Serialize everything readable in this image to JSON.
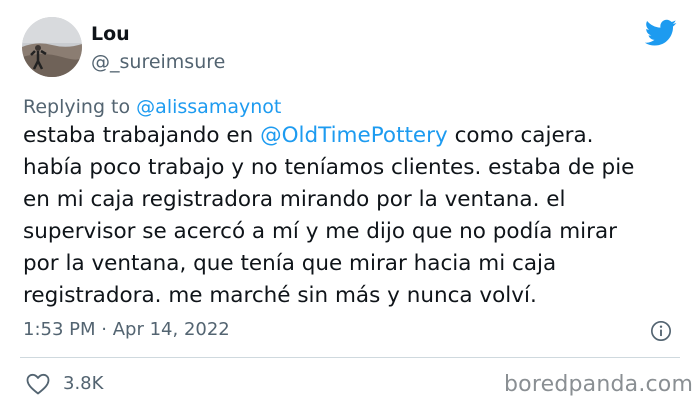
{
  "author": {
    "display_name": "Lou",
    "handle": "@_sureimsure"
  },
  "reply": {
    "prefix": "Replying to",
    "to_handle": "@alissamaynot"
  },
  "tweet": {
    "text_before_mention": "estaba trabajando en ",
    "mention": "@OldTimePottery",
    "text_after_mention": " como cajera.\nhabía poco trabajo y no teníamos clientes. estaba de pie\nen mi caja registradora mirando por la ventana. el\nsupervisor se acercó a mí y me dijo que no podía mirar\npor la ventana, que tenía que mirar hacia mi caja\nregistradora. me marché sin más y nunca volví.",
    "time": "1:53 PM",
    "separator": "·",
    "date": "Apr 14, 2022"
  },
  "stats": {
    "likes": "3.8K"
  },
  "watermark": "boredpanda.com",
  "icons": {
    "brand": "twitter-bird-icon",
    "info": "info-icon",
    "like": "heart-icon"
  },
  "colors": {
    "twitter_blue": "#1d9bf0",
    "text_primary": "#0f1419",
    "text_secondary": "#536471",
    "divider": "#cfd9de"
  }
}
